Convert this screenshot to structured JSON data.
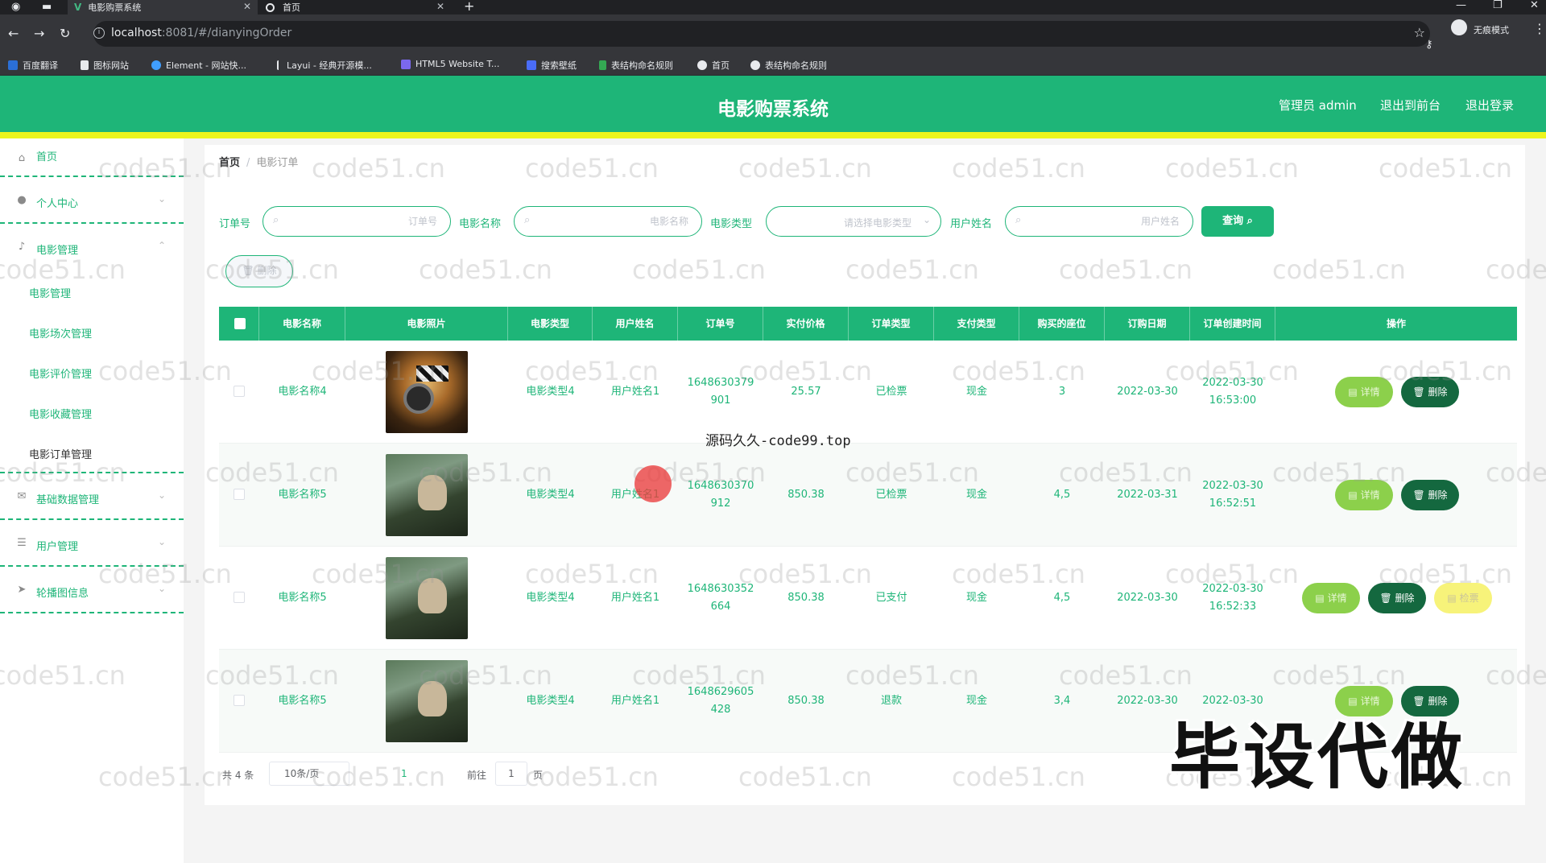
{
  "browser": {
    "tabs": [
      {
        "title": "电影购票系统",
        "active": true
      },
      {
        "title": "首页",
        "active": false
      }
    ],
    "url_host": "localhost",
    "url_path": ":8081/#/dianyingOrder",
    "incognito_label": "无痕模式",
    "bookmarks": [
      "百度翻译",
      "图标网站",
      "Element - 网站快...",
      "Layui - 经典开源模...",
      "HTML5 Website T...",
      "搜索壁纸",
      "表结构命名规则",
      "首页",
      "表结构命名规则"
    ]
  },
  "header": {
    "title": "电影购票系统",
    "admin_label": "管理员 admin",
    "to_front": "退出到前台",
    "logout": "退出登录"
  },
  "sidebar": {
    "home": "首页",
    "personal": "个人中心",
    "movie_mgmt": "电影管理",
    "sub_items": [
      "电影管理",
      "电影场次管理",
      "电影评价管理",
      "电影收藏管理",
      "电影订单管理"
    ],
    "basic_data": "基础数据管理",
    "user_mgmt": "用户管理",
    "carousel": "轮播图信息"
  },
  "breadcrumb": {
    "home": "首页",
    "separator": "/",
    "current": "电影订单"
  },
  "filters": {
    "order_no_label": "订单号",
    "order_no_placeholder": "订单号",
    "movie_name_label": "电影名称",
    "movie_name_placeholder": "电影名称",
    "movie_type_label": "电影类型",
    "movie_type_placeholder": "请选择电影类型",
    "user_name_label": "用户姓名",
    "user_name_placeholder": "用户姓名",
    "query_btn": "查询",
    "batch_delete": "删除"
  },
  "table": {
    "headers": [
      "电影名称",
      "电影照片",
      "电影类型",
      "用户姓名",
      "订单号",
      "实付价格",
      "订单类型",
      "支付类型",
      "购买的座位",
      "订购日期",
      "订单创建时间",
      "操作"
    ],
    "rows": [
      {
        "movie": "电影名称4",
        "photo": "film",
        "type": "电影类型4",
        "user": "用户姓名1",
        "order_no_a": "1648630379",
        "order_no_b": "901",
        "price": "25.57",
        "order_type": "已检票",
        "pay_type": "现金",
        "seats": "3",
        "date": "2022-03-30",
        "created_a": "2022-03-30",
        "created_b": "16:53:00"
      },
      {
        "movie": "电影名称5",
        "photo": "scene",
        "type": "电影类型4",
        "user": "用户姓名1",
        "order_no_a": "1648630370",
        "order_no_b": "912",
        "price": "850.38",
        "order_type": "已检票",
        "pay_type": "现金",
        "seats": "4,5",
        "date": "2022-03-31",
        "created_a": "2022-03-30",
        "created_b": "16:52:51"
      },
      {
        "movie": "电影名称5",
        "photo": "scene",
        "type": "电影类型4",
        "user": "用户姓名1",
        "order_no_a": "1648630352",
        "order_no_b": "664",
        "price": "850.38",
        "order_type": "已支付",
        "pay_type": "现金",
        "seats": "4,5",
        "date": "2022-03-30",
        "created_a": "2022-03-30",
        "created_b": "16:52:33"
      },
      {
        "movie": "电影名称5",
        "photo": "scene",
        "type": "电影类型4",
        "user": "用户姓名1",
        "order_no_a": "1648629605",
        "order_no_b": "428",
        "price": "850.38",
        "order_type": "退款",
        "pay_type": "现金",
        "seats": "3,4",
        "date": "2022-03-30",
        "created_a": "2022-03-30",
        "created_b": ""
      }
    ],
    "detail_btn": "详情",
    "delete_btn": "删除",
    "check_btn": "检票"
  },
  "pagination": {
    "total": "共 4 条",
    "page_size": "10条/页",
    "current_page": "1",
    "goto_label": "前往",
    "goto_value": "1",
    "page_suffix": "页"
  },
  "overlays": {
    "watermark": "code51.cn",
    "source_text": "源码久久-code99.top",
    "big_text": "毕设代做"
  },
  "colors": {
    "primary": "#1eb578",
    "accent_bar": "#ecf51d",
    "delete_btn": "#14683f",
    "detail_btn": "#8cd04b",
    "check_btn": "#f7f37a"
  }
}
